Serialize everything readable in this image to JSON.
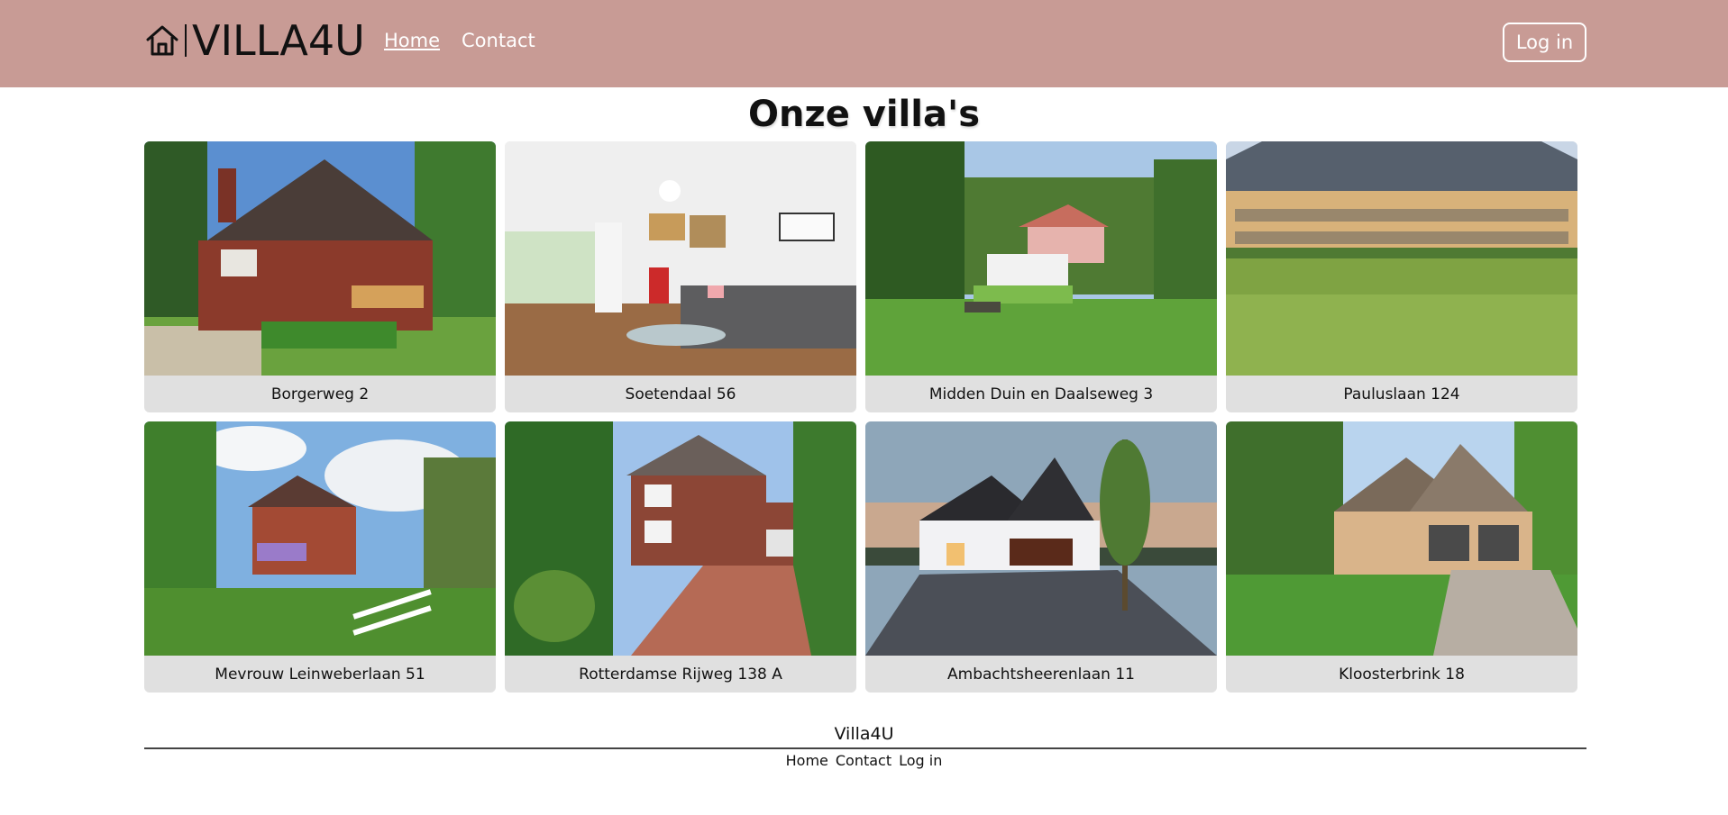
{
  "header": {
    "logo_text": "VILLA4U",
    "logo_icon": "house-icon",
    "nav": [
      {
        "label": "Home",
        "active": true
      },
      {
        "label": "Contact",
        "active": false
      }
    ],
    "login_label": "Log in",
    "background": "#c89b95"
  },
  "main": {
    "title": "Onze villa's",
    "villas": [
      {
        "name": "Borgerweg 2"
      },
      {
        "name": "Soetendaal 56"
      },
      {
        "name": "Midden Duin en Daalseweg 3"
      },
      {
        "name": "Pauluslaan 124"
      },
      {
        "name": "Mevrouw Leinweberlaan 51"
      },
      {
        "name": "Rotterdamse Rijweg 138 A"
      },
      {
        "name": "Ambachtsheerenlaan 11"
      },
      {
        "name": "Kloosterbrink 18"
      }
    ]
  },
  "footer": {
    "title": "Villa4U",
    "links": [
      "Home",
      "Contact",
      "Log in"
    ]
  }
}
